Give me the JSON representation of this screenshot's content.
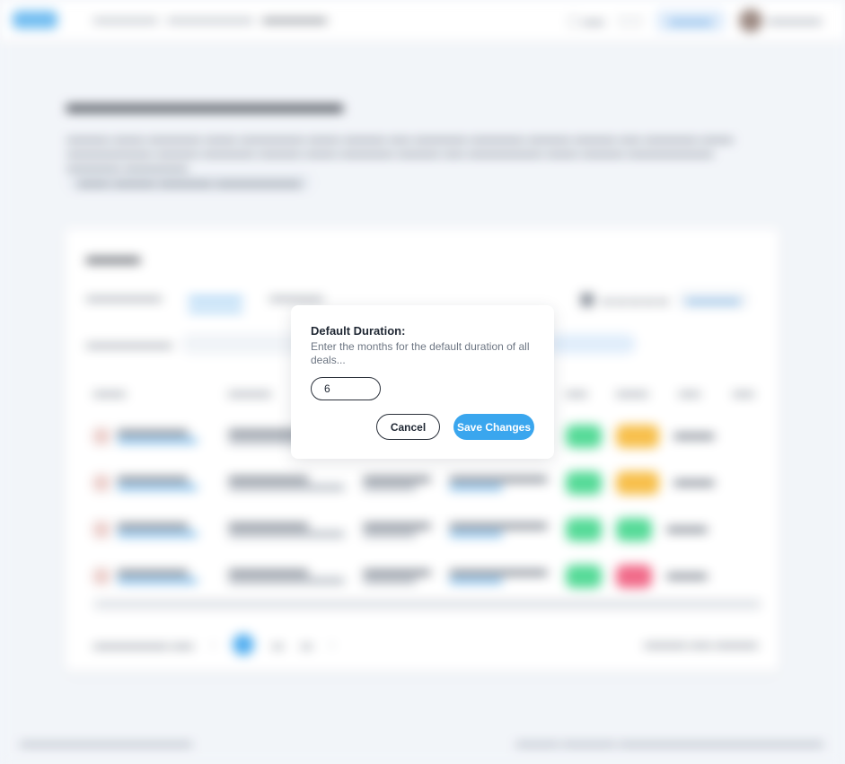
{
  "modal": {
    "title": "Default Duration:",
    "description": "Enter the months for the default duration of all deals...",
    "input_value": "6",
    "cancel_label": "Cancel",
    "save_label": "Save Changes"
  },
  "colors": {
    "primary": "#3aa6ee",
    "status_green": "#3fd68a",
    "status_orange": "#f7b733",
    "status_red": "#f0577a"
  }
}
